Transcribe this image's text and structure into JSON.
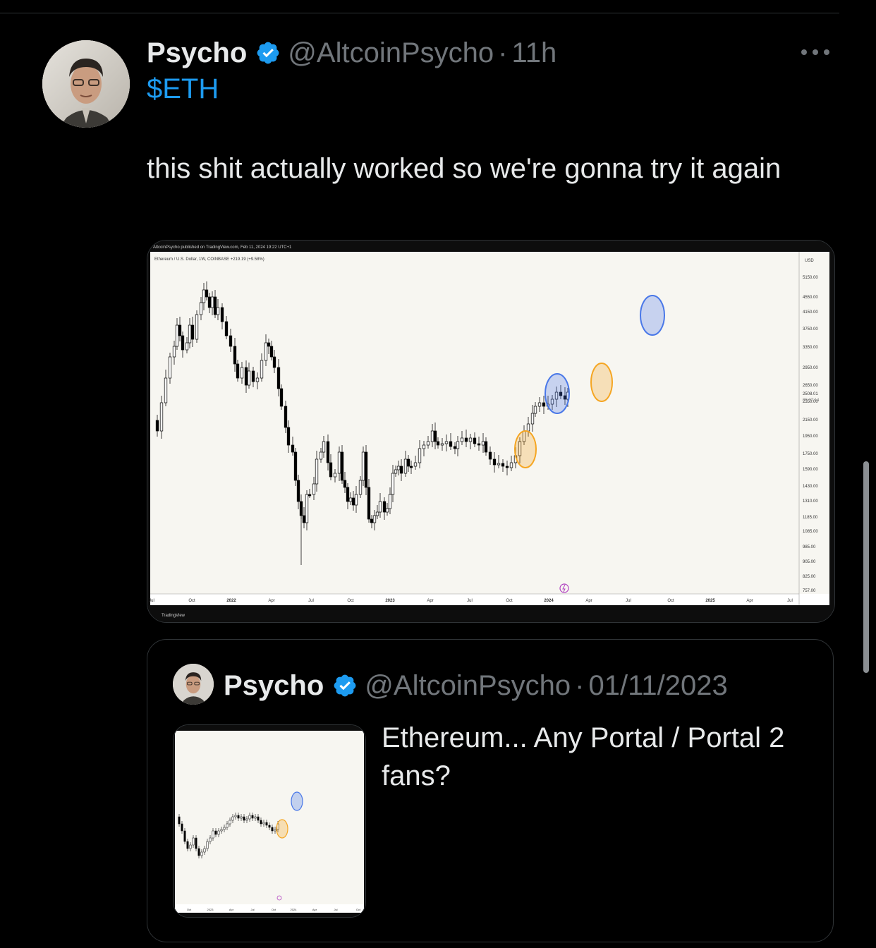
{
  "tweet": {
    "author_name": "Psycho",
    "handle": "@AltcoinPsycho",
    "separator": "·",
    "time": "11h",
    "cashtag": "$ETH",
    "text": "this shit actually worked so we're gonna try it again"
  },
  "chart_image": {
    "published_line": "AltcoinPsycho published on TradingView.com, Feb 11, 2024 19:22 UTC+1",
    "symbol_line": "Ethereum / U.S. Dollar, 1W, COINBASE  +219.19 (+9.58%)",
    "currency": "USD",
    "price_labels": [
      "5150.00",
      "4550.00",
      "4150.00",
      "3750.00",
      "3350.00",
      "2950.00",
      "2650.00",
      "2350.00",
      "2150.00",
      "1950.00",
      "1750.00",
      "1590.00",
      "1430.00",
      "1310.00",
      "1185.00",
      "1085.00",
      "985.00",
      "905.00",
      "825.00",
      "757.00"
    ],
    "current_price": "2508.01",
    "countdown": "05:37:14",
    "time_labels": [
      "Jul",
      "Oct",
      "2022",
      "Apr",
      "Jul",
      "Oct",
      "2023",
      "Apr",
      "Jul",
      "Oct",
      "2024",
      "Apr",
      "Jul",
      "Oct",
      "2025",
      "Apr",
      "Jul"
    ],
    "watermark": "TradingView",
    "colors": {
      "orange_circle": "#f5a623",
      "blue_circle": "#4a78e8",
      "background": "#f7f6f1",
      "candles": "#000000"
    }
  },
  "quoted_tweet": {
    "author_name": "Psycho",
    "handle": "@AltcoinPsycho",
    "separator": "·",
    "date": "01/11/2023",
    "text": "Ethereum... Any Portal / Portal 2 fans?",
    "thumb_time_labels": [
      "Oct",
      "2023",
      "Apr",
      "Jul",
      "Oct",
      "2024",
      "Apr",
      "Jul",
      "Oct"
    ]
  },
  "icons": {
    "verified": "verified-badge-icon",
    "more": "more-options-icon",
    "lightning": "lightning-icon"
  }
}
